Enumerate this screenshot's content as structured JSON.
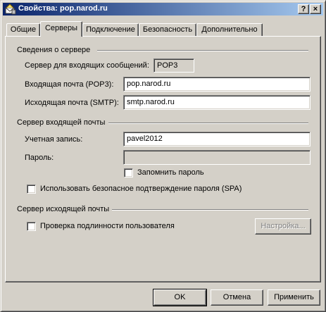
{
  "window": {
    "title": "Свойства: pop.narod.ru",
    "help_label": "?",
    "close_label": "×"
  },
  "tabs": [
    {
      "label": "Общие"
    },
    {
      "label": "Серверы"
    },
    {
      "label": "Подключение"
    },
    {
      "label": "Безопасность"
    },
    {
      "label": "Дополнительно"
    }
  ],
  "server_info": {
    "heading": "Сведения о сервере",
    "incoming_type_label": "Сервер для входящих сообщений:",
    "incoming_type_value": "POP3",
    "incoming_label": "Входящая почта (POP3):",
    "incoming_value": "pop.narod.ru",
    "outgoing_label": "Исходящая почта (SMTP):",
    "outgoing_value": "smtp.narod.ru"
  },
  "incoming_server": {
    "heading": "Сервер входящей почты",
    "account_label": "Учетная запись:",
    "account_value": "pavel2012",
    "password_label": "Пароль:",
    "password_value": "",
    "remember_label": "Запомнить пароль",
    "spa_label": "Использовать безопасное подтверждение пароля (SPA)"
  },
  "outgoing_server": {
    "heading": "Сервер исходящей почты",
    "auth_label": "Проверка подлинности пользователя",
    "settings_button": "Настройка..."
  },
  "buttons": {
    "ok": "OK",
    "cancel": "Отмена",
    "apply": "Применить"
  }
}
